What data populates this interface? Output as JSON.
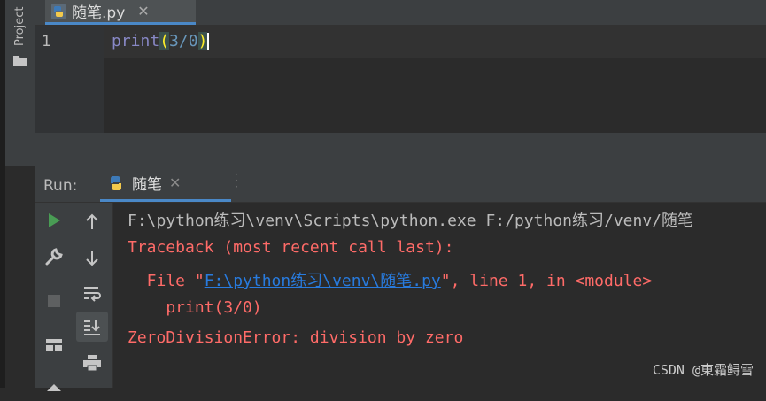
{
  "sidebar": {
    "project_label": "Project"
  },
  "editor_tab": {
    "filename": "随笔.py",
    "close_glyph": "✕"
  },
  "editor": {
    "line_number": "1",
    "code": {
      "func": "print",
      "open_paren": "(",
      "expr": "3/0",
      "close_paren": ")"
    }
  },
  "run_panel": {
    "label": "Run:",
    "tab_name": "随笔",
    "close_glyph": "✕",
    "tools": [
      "run-icon",
      "up-arrow-icon",
      "wrench-icon",
      "down-arrow-icon",
      "stop-icon",
      "soft-wrap-icon",
      "scroll-to-end-icon",
      "layout-icon",
      "print-icon",
      "pin-icon"
    ]
  },
  "console": {
    "command": "F:\\python练习\\venv\\Scripts\\python.exe F:/python练习/venv/随笔",
    "traceback": "Traceback (most recent call last):",
    "file_prefix": "  File \"",
    "file_link": "F:\\python练习\\venv\\随笔.py",
    "file_suffix": "\", line 1, in <module>",
    "code_line": "    print(3/0)",
    "error": "ZeroDivisionError: division by zero"
  },
  "watermark": "CSDN @東霜鲟雪",
  "colors": {
    "accent": "#4a88c7",
    "error": "#ff6b68",
    "link": "#287bde",
    "run_green": "#499c54"
  }
}
